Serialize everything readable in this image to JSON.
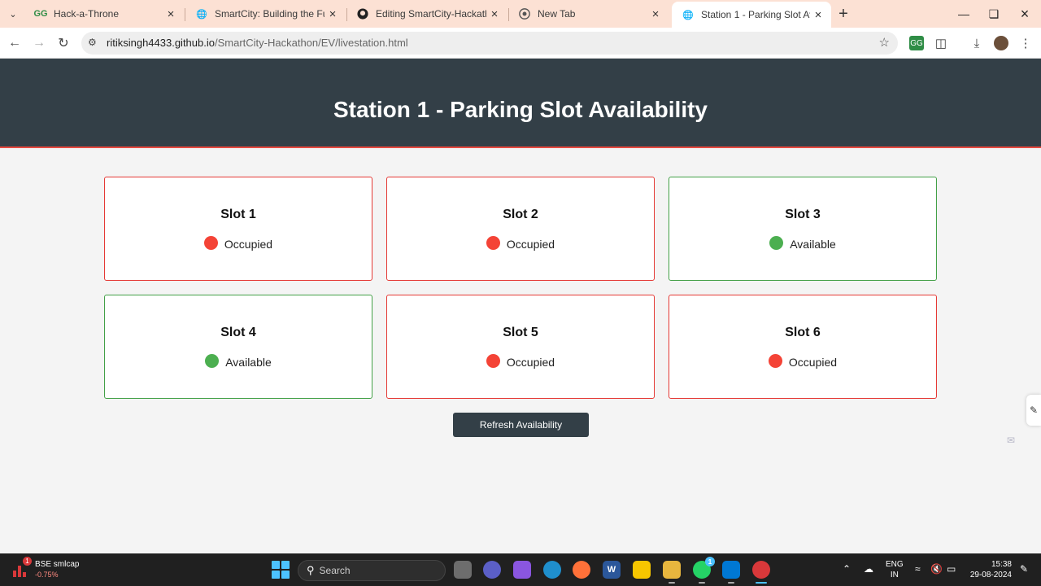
{
  "browser": {
    "tabs": [
      {
        "title": "Hack-a-Throne",
        "favicon": "geeksforgeeks-icon",
        "active": false
      },
      {
        "title": "SmartCity: Building the Future",
        "favicon": "globe-icon",
        "active": false
      },
      {
        "title": "Editing SmartCity-Hackathon/R",
        "favicon": "github-icon",
        "active": false
      },
      {
        "title": "New Tab",
        "favicon": "chrome-icon",
        "active": false
      },
      {
        "title": "Station 1 - Parking Slot Availab",
        "favicon": "globe-icon",
        "active": true
      }
    ],
    "url_host": "ritiksingh4433.github.io",
    "url_path": "/SmartCity-Hackathon/EV/livestation.html"
  },
  "page": {
    "title": "Station 1 - Parking Slot Availability",
    "slots": [
      {
        "name": "Slot 1",
        "status": "Occupied"
      },
      {
        "name": "Slot 2",
        "status": "Occupied"
      },
      {
        "name": "Slot 3",
        "status": "Available"
      },
      {
        "name": "Slot 4",
        "status": "Available"
      },
      {
        "name": "Slot 5",
        "status": "Occupied"
      },
      {
        "name": "Slot 6",
        "status": "Occupied"
      }
    ],
    "refresh_label": "Refresh Availability",
    "colors": {
      "occupied": "#f44336",
      "available": "#4caf50",
      "header": "#333f47"
    }
  },
  "taskbar": {
    "widget_title": "BSE smlcap",
    "widget_change": "-0.75%",
    "widget_badge": "1",
    "search_placeholder": "Search",
    "whatsapp_badge": "1",
    "lang_top": "ENG",
    "lang_bottom": "IN",
    "time": "15:38",
    "date": "29-08-2024"
  }
}
